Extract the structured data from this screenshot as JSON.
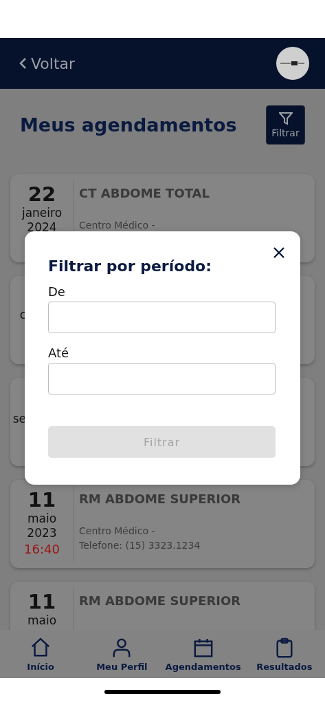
{
  "header": {
    "back_label": "Voltar"
  },
  "page": {
    "title": "Meus agendamentos",
    "filter_button": "Filtrar"
  },
  "appointments": [
    {
      "kind": "full",
      "day": "22",
      "month": "janeiro",
      "year": "2024",
      "title": "CT ABDOME TOTAL",
      "clinic": "Centro Médico -"
    },
    {
      "kind": "fragment",
      "fragment": "c"
    },
    {
      "kind": "fragment",
      "fragment": "se"
    },
    {
      "kind": "full",
      "day": "11",
      "month": "maio",
      "year": "2023",
      "time": "16:40",
      "title": "RM ABDOME SUPERIOR",
      "clinic": "Centro Médico -",
      "phone": "Telefone: (15) 3323.1234"
    },
    {
      "kind": "full",
      "day": "11",
      "month": "maio",
      "title": "RM ABDOME SUPERIOR"
    }
  ],
  "modal": {
    "title": "Filtrar por período:",
    "fields": [
      {
        "label": "De"
      },
      {
        "label": "Até"
      }
    ],
    "button": {
      "label": "Filtrar",
      "disabled": true
    }
  },
  "bottom_nav": [
    {
      "label": "Início",
      "kind": "home"
    },
    {
      "label": "Meu Perfil",
      "kind": "person"
    },
    {
      "label": "Agendamentos",
      "kind": "calendar"
    },
    {
      "label": "Resultados",
      "kind": "clipboard"
    }
  ]
}
